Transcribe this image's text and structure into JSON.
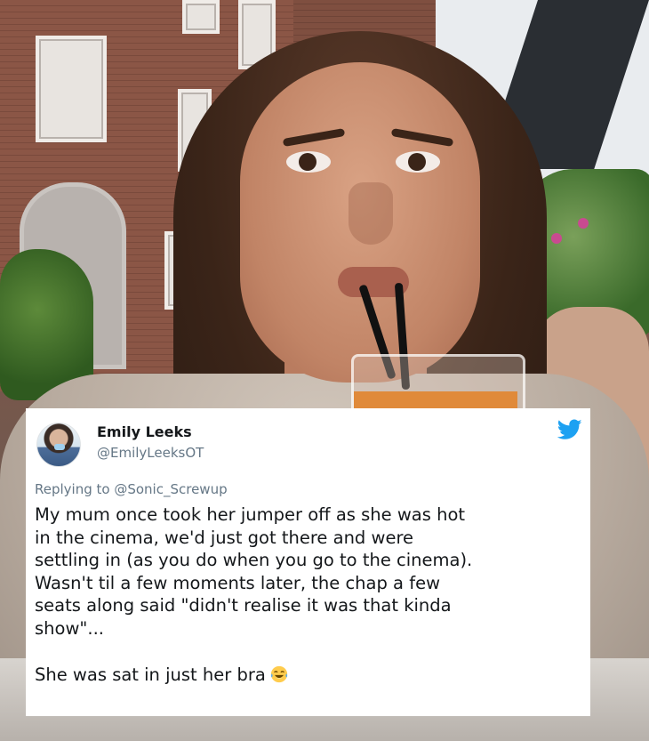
{
  "photo": {
    "description_icon": "photo-background"
  },
  "tweet": {
    "display_name": "Emily Leeks",
    "handle": "@EmilyLeeksOT",
    "replying_prefix": "Replying to ",
    "replying_to": "@Sonic_Screwup",
    "lines": [
      "My mum once took her jumper off as she was hot",
      "in the cinema, we'd just got there and were",
      "settling in (as you do when you go to the cinema).",
      "Wasn't til a few moments later, the chap a few",
      "seats along said \"didn't realise it was that kinda",
      "show\"..."
    ],
    "last_line": "She was sat in just her bra",
    "emoji": "face-with-tears-of-joy-icon",
    "platform_icon": "twitter-bird-icon",
    "colors": {
      "card_bg": "#ffffff",
      "text": "#14171a",
      "secondary": "#657786",
      "brand": "#1da1f2"
    }
  }
}
